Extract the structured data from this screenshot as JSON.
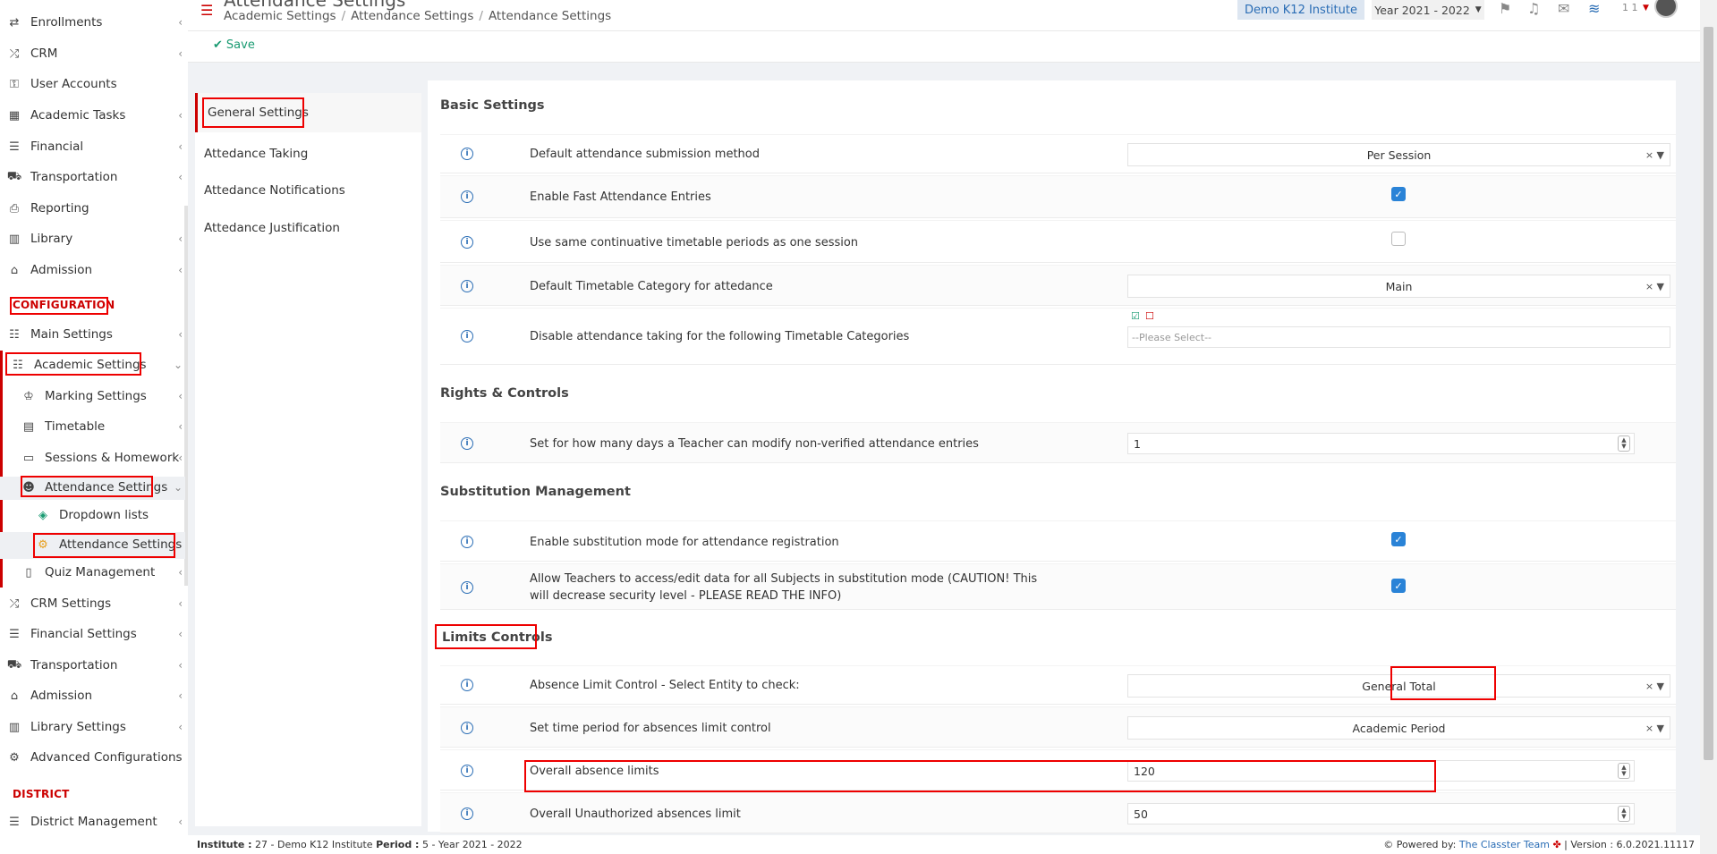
{
  "sidebar": {
    "items": [
      {
        "label": "Enrollments",
        "icon": "arrows-icon",
        "glyph": "⇄",
        "chev": true
      },
      {
        "label": "CRM",
        "icon": "shuffle-icon",
        "glyph": "⤮",
        "chev": true
      },
      {
        "label": "User Accounts",
        "icon": "key-icon",
        "glyph": "⚿",
        "chev": false
      },
      {
        "label": "Academic Tasks",
        "icon": "grid-icon",
        "glyph": "▦",
        "chev": true
      },
      {
        "label": "Financial",
        "icon": "money-icon",
        "glyph": "☰",
        "chev": true
      },
      {
        "label": "Transportation",
        "icon": "bus-icon",
        "glyph": "⛟",
        "chev": true
      },
      {
        "label": "Reporting",
        "icon": "print-icon",
        "glyph": "⎙",
        "chev": false
      },
      {
        "label": "Library",
        "icon": "books-icon",
        "glyph": "▥",
        "chev": true
      },
      {
        "label": "Admission",
        "icon": "institution-icon",
        "glyph": "⌂",
        "chev": true
      }
    ],
    "config_title": "CONFIGURATION",
    "config_items": [
      {
        "label": "Main Settings",
        "icon": "sliders-icon",
        "glyph": "☷",
        "chev": true
      },
      {
        "label": "Academic Settings",
        "icon": "users-icon",
        "glyph": "☷",
        "chev": true
      }
    ],
    "academic_sub": [
      {
        "label": "Marking Settings",
        "icon": "graduation-cap-icon",
        "glyph": "♔"
      },
      {
        "label": "Timetable",
        "icon": "calendar-icon",
        "glyph": "▤"
      },
      {
        "label": "Sessions & Homework",
        "icon": "chalkboard-icon",
        "glyph": "▭"
      },
      {
        "label": "Attendance Settings",
        "icon": "user-check-icon",
        "glyph": "☻"
      }
    ],
    "attendance_sub": [
      {
        "label": "Dropdown lists",
        "icon": "layers-icon",
        "glyph": "◈"
      },
      {
        "label": "Attendance Settings",
        "icon": "gear-icon",
        "glyph": "⚙"
      }
    ],
    "quiz": {
      "label": "Quiz Management",
      "icon": "book-icon",
      "glyph": "▯"
    },
    "more_items": [
      {
        "label": "CRM Settings",
        "icon": "shuffle-icon",
        "glyph": "⤮",
        "chev": true
      },
      {
        "label": "Financial Settings",
        "icon": "money-icon",
        "glyph": "☰",
        "chev": true
      },
      {
        "label": "Transportation",
        "icon": "bus-icon",
        "glyph": "⛟",
        "chev": true
      },
      {
        "label": "Admission",
        "icon": "institution-icon",
        "glyph": "⌂",
        "chev": true
      },
      {
        "label": "Library Settings",
        "icon": "books-icon",
        "glyph": "▥",
        "chev": true
      },
      {
        "label": "Advanced Configurations",
        "icon": "gears-icon",
        "glyph": "⚙",
        "chev": false
      }
    ],
    "district_title": "DISTRICT",
    "district_item": {
      "label": "District Management",
      "icon": "list-icon",
      "glyph": "☰",
      "chev": true
    }
  },
  "header": {
    "title": "Attendance Settings",
    "breadcrumb": [
      "Academic Settings",
      "Attendance Settings",
      "Attendance Settings"
    ],
    "institute": "Demo K12 Institute",
    "year": "Year 2021 - 2022",
    "user_count": "1 1"
  },
  "toolbar": {
    "save_label": "Save"
  },
  "tabs": [
    "General Settings",
    "Attedance Taking",
    "Attedance Notifications",
    "Attedance Justification"
  ],
  "sections": {
    "basic": "Basic Settings",
    "rights": "Rights & Controls",
    "substitution": "Substitution Management",
    "limits": "Limits Controls"
  },
  "settings": {
    "submission_method": {
      "label": "Default attendance submission method",
      "value": "Per Session"
    },
    "fast_entries": {
      "label": "Enable Fast Attendance Entries",
      "checked": true
    },
    "same_periods": {
      "label": "Use same continuative timetable periods as one session",
      "checked": false
    },
    "timetable_category": {
      "label": "Default Timetable Category for attedance",
      "value": "Main"
    },
    "disable_categories": {
      "label": "Disable attendance taking for the following Timetable Categories",
      "placeholder": "--Please Select--"
    },
    "modify_days": {
      "label": "Set for how many days a Teacher can modify non-verified attendance entries",
      "value": "1"
    },
    "substitution_mode": {
      "label": "Enable substitution mode for attendance registration",
      "checked": true
    },
    "teacher_access": {
      "label": "Allow Teachers to access/edit data for all Subjects in substitution mode (CAUTION! This will decrease security level - PLEASE READ THE INFO)",
      "checked": true
    },
    "absence_entity": {
      "label": "Absence Limit Control - Select Entity to check:",
      "value": "General Total"
    },
    "time_period": {
      "label": "Set time period for absences limit control",
      "value": "Academic Period"
    },
    "overall_limit": {
      "label": "Overall absence limits",
      "value": "120"
    },
    "unauthorized_limit": {
      "label": "Overall Unauthorized absences limit",
      "value": "50"
    }
  },
  "footer": {
    "institute_label": "Institute :",
    "institute_value": "27 - Demo K12 Institute",
    "period_label": "Period :",
    "period_value": "5 - Year 2021 - 2022",
    "powered_label": "Powered by:",
    "powered_link": "The Classter Team",
    "version": "| Version : 6.0.2021.11117"
  },
  "colors": {
    "accent": "#c00000",
    "link": "#2a6db5",
    "check": "#2a83d7",
    "save": "#1a9b72"
  }
}
